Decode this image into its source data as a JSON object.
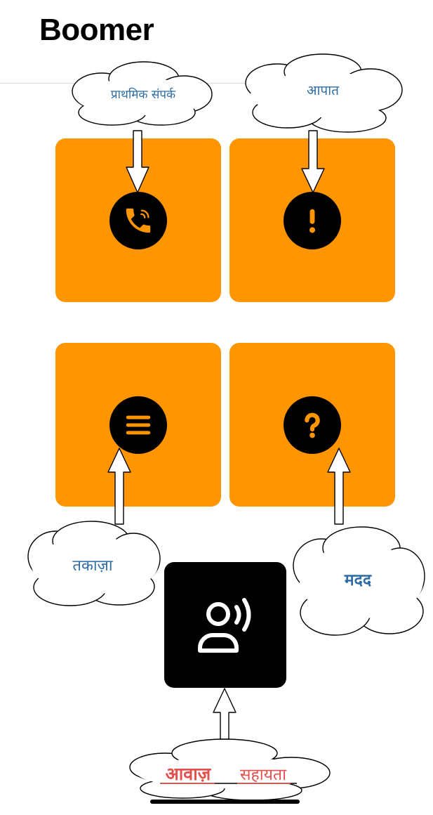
{
  "app": {
    "title": "Boomer"
  },
  "colors": {
    "tile": "#FF9500",
    "voice_tile": "#000000",
    "cloud_text": "#2E6DA4",
    "voice_label": "#E4504C"
  },
  "tiles": [
    {
      "id": "primary-contact",
      "icon": "phone-icon"
    },
    {
      "id": "emergency",
      "icon": "exclamation-icon"
    },
    {
      "id": "demand",
      "icon": "menu-lines-icon"
    },
    {
      "id": "help",
      "icon": "question-icon"
    }
  ],
  "voice_button": {
    "icon": "voice-assist-icon"
  },
  "annotations": {
    "primary_contact": "प्राथमिक संपर्क",
    "emergency": "आपात",
    "demand": "तकाज़ा",
    "help": "मदद",
    "voice_word1": "आवाज़",
    "voice_word2": "सहायता"
  }
}
